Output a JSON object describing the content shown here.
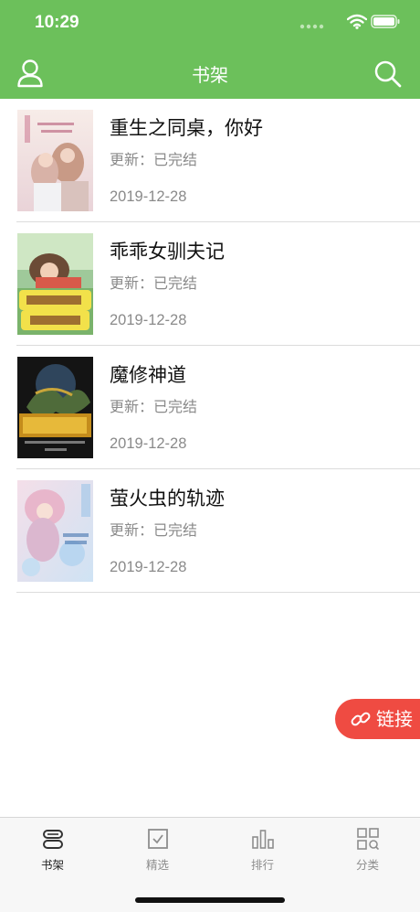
{
  "status_bar": {
    "time": "10:29"
  },
  "header": {
    "title": "书架"
  },
  "books": [
    {
      "title": "重生之同桌，你好",
      "update": "更新：已完结",
      "date": "2019-12-28"
    },
    {
      "title": "乖乖女驯夫记",
      "update": "更新：已完结",
      "date": "2019-12-28"
    },
    {
      "title": "魔修神道",
      "update": "更新：已完结",
      "date": "2019-12-28"
    },
    {
      "title": "萤火虫的轨迹",
      "update": "更新：已完结",
      "date": "2019-12-28"
    }
  ],
  "floating_button": {
    "label": "链接"
  },
  "tabbar": {
    "tabs": [
      {
        "label": "书架",
        "icon": "bookshelf-icon",
        "active": true
      },
      {
        "label": "精选",
        "icon": "featured-icon",
        "active": false
      },
      {
        "label": "排行",
        "icon": "ranking-icon",
        "active": false
      },
      {
        "label": "分类",
        "icon": "category-icon",
        "active": false
      }
    ]
  },
  "colors": {
    "header_bg": "#6cc05b",
    "float_button_bg": "#ef4b42",
    "tabbar_bg": "#f7f7f7"
  }
}
